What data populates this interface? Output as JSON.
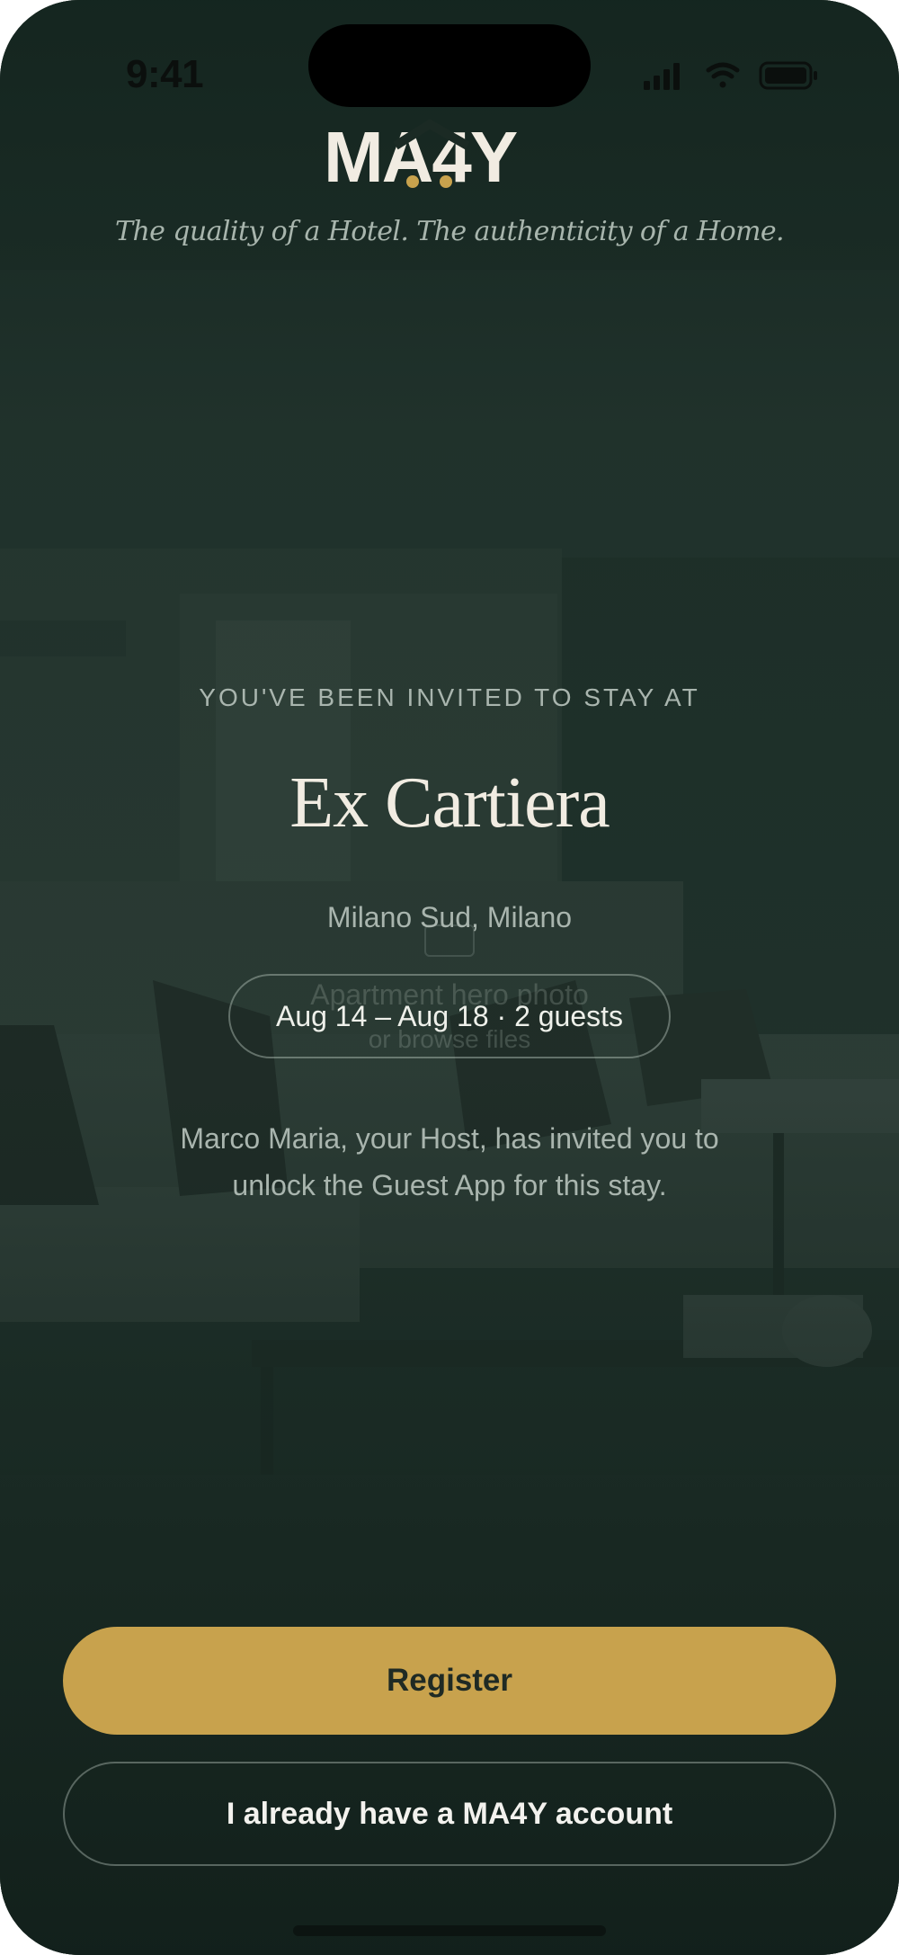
{
  "status_bar": {
    "time": "9:41"
  },
  "brand": {
    "logo_text": "MA4Y",
    "tagline": "The quality of a Hotel. The authenticity of a Home."
  },
  "invite": {
    "kicker": "YOU'VE BEEN INVITED TO STAY AT",
    "property_name": "Ex Cartiera",
    "location": "Milano Sud, Milano",
    "dates": "Aug 14 – Aug 18 · 2 guests",
    "message": "Marco Maria, your Host, has invited you to unlock the Guest App for this stay."
  },
  "hero_placeholder": {
    "label": "Apartment hero photo",
    "sublabel": "or browse files"
  },
  "actions": {
    "register_label": "Register",
    "login_label": "I already have a MA4Y account"
  },
  "colors": {
    "accent": "#c8a24d",
    "background": "#1b2a24",
    "text_light": "#f1ece2"
  }
}
